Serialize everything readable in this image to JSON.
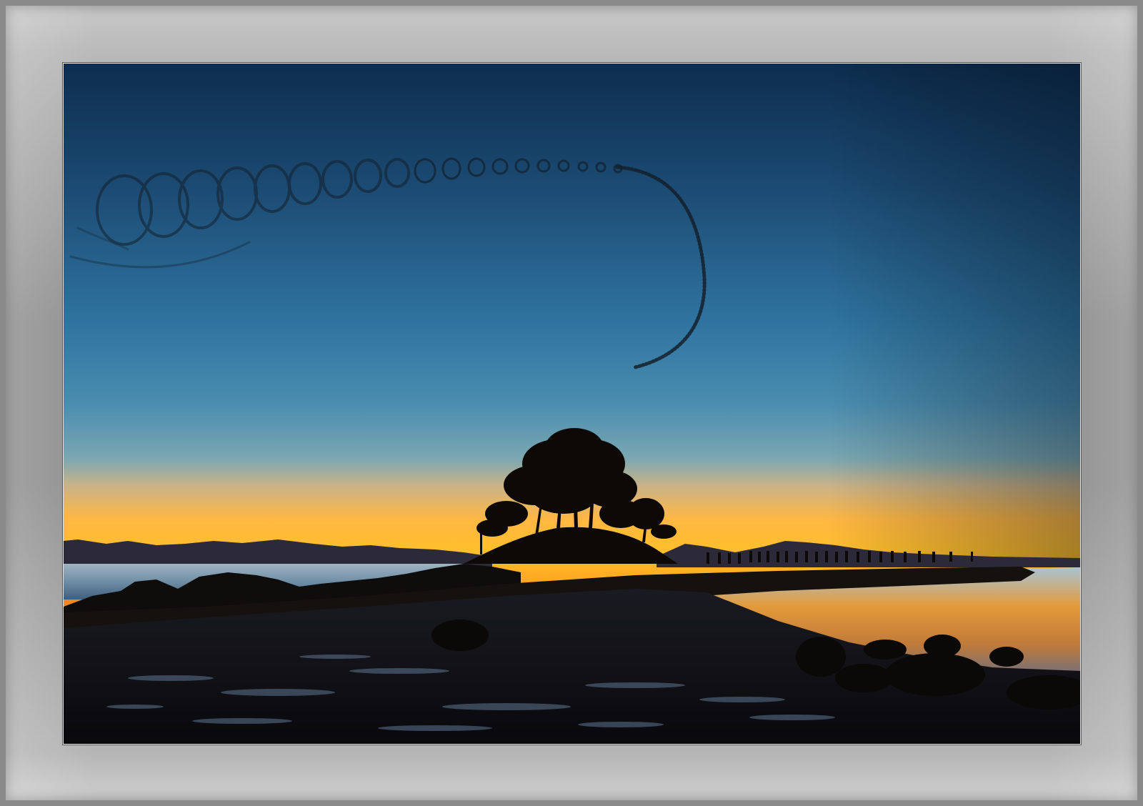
{
  "image": {
    "frame_color": "#8f8f8f",
    "sky_top": "#0b2a4a",
    "sky_mid": "#3f86ad",
    "horizon_orange": "#ffb21e",
    "horizon_yellow": "#ffd23a",
    "silhouette": "#0c0906"
  }
}
